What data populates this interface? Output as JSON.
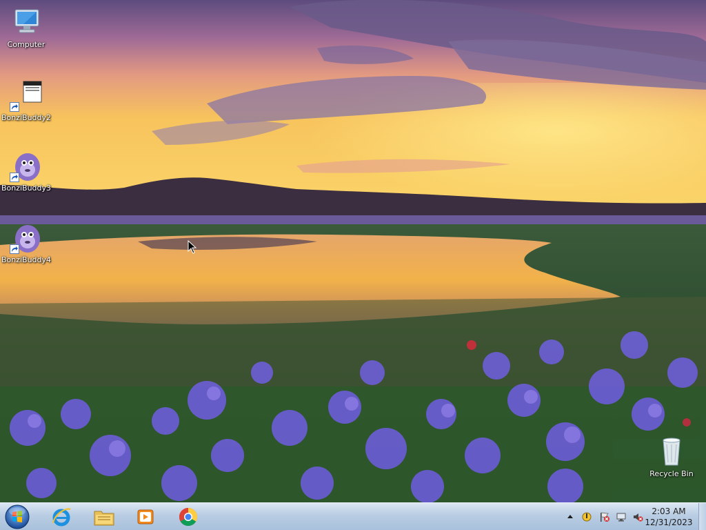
{
  "desktop": {
    "icons": [
      {
        "label": "Computer",
        "icon": "computer-icon"
      },
      {
        "label": "BonziBuddy2",
        "icon": "bonzi-window-icon"
      },
      {
        "label": "BonziBuddy3",
        "icon": "bonzi-gorilla-icon"
      },
      {
        "label": "BonziBuddy4",
        "icon": "bonzi-gorilla-icon"
      },
      {
        "label": "Recycle Bin",
        "icon": "recycle-bin-icon"
      }
    ]
  },
  "taskbar": {
    "start": "start-orb-icon",
    "pinned": [
      "internet-explorer-icon",
      "file-explorer-icon",
      "media-player-icon",
      "chrome-icon"
    ],
    "tray": [
      "show-hidden-icons-icon",
      "action-center-icon",
      "flag-icon",
      "network-icon",
      "volume-muted-icon"
    ],
    "clock": {
      "time": "2:03 AM",
      "date": "12/31/2023"
    }
  },
  "colors": {
    "taskbar": "#b9cde3",
    "sky_top": "#6b5a8c",
    "sunset": "#f4b23a",
    "flowers": "#6a5cd6"
  }
}
